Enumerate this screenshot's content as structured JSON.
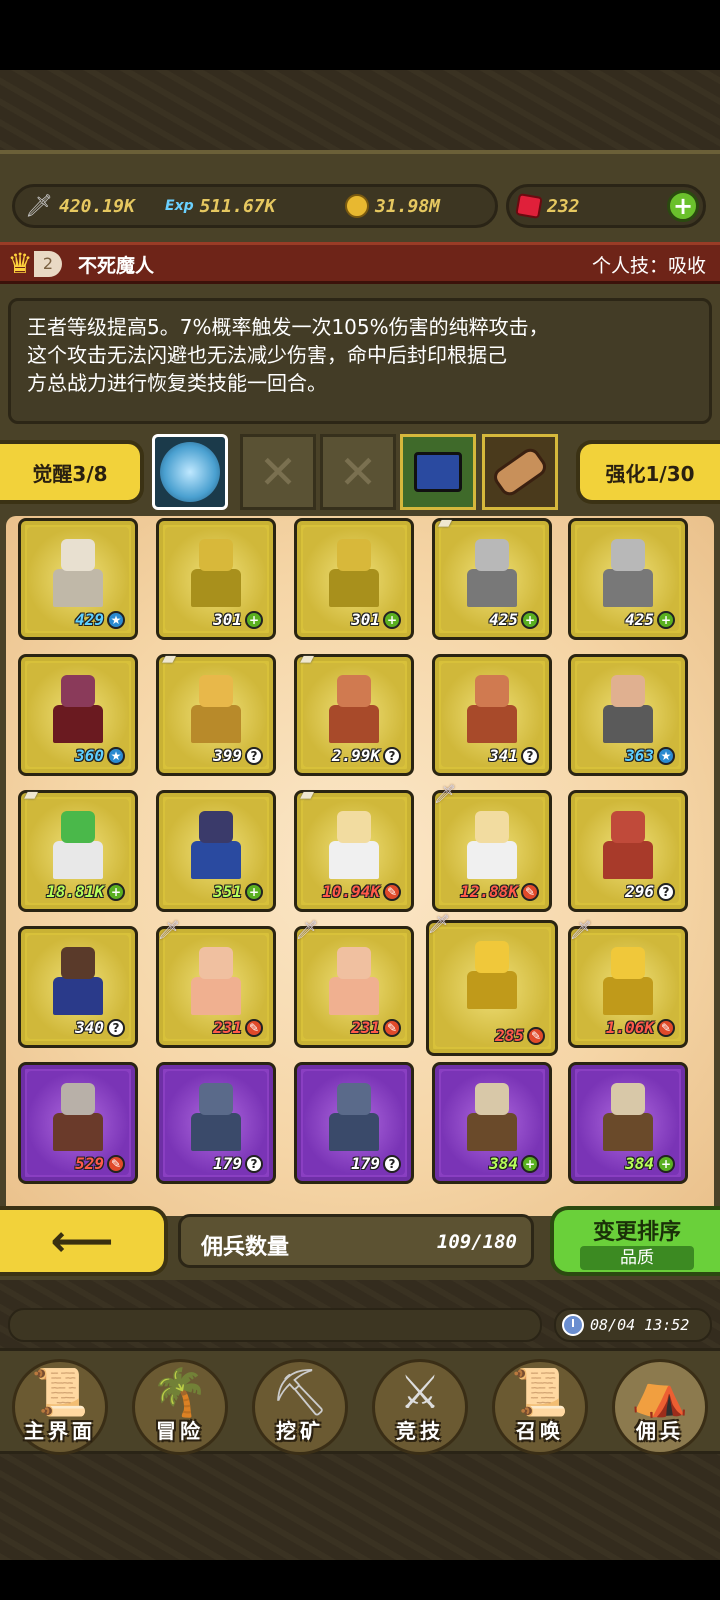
{
  "resources": {
    "attack": "420.19K",
    "exp": "511.67K",
    "gold": "31.98M",
    "gems": "232"
  },
  "hero": {
    "rank": "2",
    "name": "不死魔人",
    "skill": "个人技：吸收",
    "description_lines": [
      "王者等级提高5。7%概率触发一次105%伤害的纯粹攻击，",
      "这个攻击无法闪避也无法减少伤害，命中后封印根据己",
      "方总战力进行恢复类技能一回合。"
    ]
  },
  "awaken": {
    "label": "觉醒3/8"
  },
  "enhance": {
    "label": "强化1/30"
  },
  "grid": {
    "rows": [
      [
        {
          "level": "429",
          "badge": "star",
          "color": "blue",
          "frame": "gold",
          "corner": ""
        },
        {
          "level": "301",
          "badge": "plus",
          "color": "white",
          "frame": "gold",
          "corner": ""
        },
        {
          "level": "301",
          "badge": "plus",
          "color": "white",
          "frame": "gold",
          "corner": ""
        },
        {
          "level": "425",
          "badge": "plus",
          "color": "white",
          "frame": "gold",
          "corner": "scroll"
        },
        {
          "level": "425",
          "badge": "plus",
          "color": "white",
          "frame": "gold",
          "corner": ""
        }
      ],
      [
        {
          "level": "360",
          "badge": "star",
          "color": "blue",
          "frame": "gold",
          "corner": ""
        },
        {
          "level": "399",
          "badge": "q",
          "color": "white",
          "frame": "gold",
          "corner": "scroll"
        },
        {
          "level": "2.99K",
          "badge": "q",
          "color": "white",
          "frame": "gold",
          "corner": "scroll"
        },
        {
          "level": "341",
          "badge": "q",
          "color": "white",
          "frame": "gold",
          "corner": ""
        },
        {
          "level": "363",
          "badge": "star",
          "color": "blue",
          "frame": "gold",
          "corner": ""
        }
      ],
      [
        {
          "level": "18.81K",
          "badge": "plus",
          "color": "green",
          "frame": "gold",
          "corner": "scroll"
        },
        {
          "level": "351",
          "badge": "plus",
          "color": "green",
          "frame": "gold",
          "corner": ""
        },
        {
          "level": "10.94K",
          "badge": "x",
          "color": "red",
          "frame": "gold",
          "corner": "scroll"
        },
        {
          "level": "12.88K",
          "badge": "x",
          "color": "red",
          "frame": "gold",
          "corner": "sword"
        },
        {
          "level": "296",
          "badge": "q",
          "color": "white",
          "frame": "gold",
          "corner": ""
        }
      ],
      [
        {
          "level": "340",
          "badge": "q",
          "color": "white",
          "frame": "gold",
          "corner": ""
        },
        {
          "level": "231",
          "badge": "x",
          "color": "red",
          "frame": "gold",
          "corner": "sword"
        },
        {
          "level": "231",
          "badge": "x",
          "color": "red",
          "frame": "gold",
          "corner": "sword"
        },
        {
          "level": "285",
          "badge": "x",
          "color": "red",
          "frame": "gold",
          "corner": "sword"
        },
        {
          "level": "1.06K",
          "badge": "x",
          "color": "red",
          "frame": "gold",
          "corner": "sword"
        }
      ],
      [
        {
          "level": "529",
          "badge": "x",
          "color": "red",
          "frame": "purple",
          "corner": ""
        },
        {
          "level": "179",
          "badge": "q",
          "color": "white",
          "frame": "purple",
          "corner": ""
        },
        {
          "level": "179",
          "badge": "q",
          "color": "white",
          "frame": "purple",
          "corner": ""
        },
        {
          "level": "384",
          "badge": "plus",
          "color": "green",
          "frame": "purple",
          "corner": ""
        },
        {
          "level": "384",
          "badge": "plus",
          "color": "green",
          "frame": "purple",
          "corner": ""
        }
      ]
    ]
  },
  "bottom": {
    "count_label": "佣兵数量",
    "count_value": "109/180",
    "sort_label": "变更排序",
    "sort_sub": "品质",
    "time": "08/04 13:52"
  },
  "nav": [
    {
      "label": "主界面",
      "icon": "map-scroll-icon"
    },
    {
      "label": "冒险",
      "icon": "island-icon"
    },
    {
      "label": "挖矿",
      "icon": "pickaxe-icon"
    },
    {
      "label": "竞技",
      "icon": "crossed-swords-icon"
    },
    {
      "label": "召唤",
      "icon": "summon-scroll-icon"
    },
    {
      "label": "佣兵",
      "icon": "tent-icon"
    }
  ]
}
